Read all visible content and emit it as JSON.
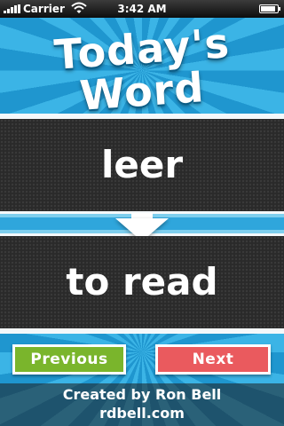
{
  "status_bar": {
    "carrier": "Carrier",
    "time": "3:42 AM",
    "battery_level": 1.0,
    "icons": [
      "signal-bars-icon",
      "wifi-icon",
      "battery-icon"
    ]
  },
  "header": {
    "title_line1": "Today's",
    "title_line2": "Word"
  },
  "word": {
    "term": "leer",
    "translation": "to read"
  },
  "buttons": {
    "previous": "Previous",
    "next": "Next"
  },
  "credits": {
    "line1": "Created by Ron Bell",
    "line2": "rdbell.com"
  },
  "colors": {
    "sky_blue": "#2fa6dc",
    "previous_button": "#7ab52c",
    "next_button": "#ea5a5e",
    "panel_dark": "#2a2a2a"
  }
}
